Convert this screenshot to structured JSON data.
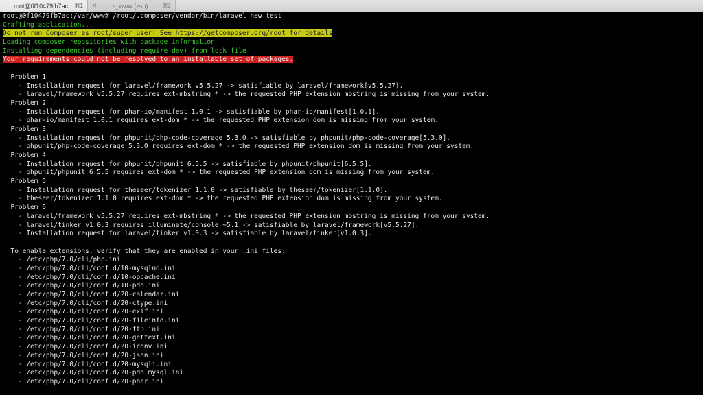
{
  "tabs": [
    {
      "title": "root@0f10479fb7ac:...",
      "shortcut": "⌘1",
      "close": ""
    },
    {
      "title": "~_www (zsh)",
      "shortcut": "⌘2",
      "close": "✕"
    }
  ],
  "colors": {
    "info_text": "#3fcc2f",
    "warning_bg": "#c6cc16",
    "error_bg": "#cc2222",
    "default_text": "#e8e8e8",
    "background": "#000000"
  },
  "terminal": {
    "command_line": "root@0f10479fb7ac:/var/www# /root/.composer/vendor/bin/laravel new test",
    "crafting": "Crafting application...",
    "warning": "Do not run Composer as root/super user! See https://getcomposer.org/root for details",
    "loading": "Loading composer repositories with package information",
    "installing": "Installing dependencies (including require-dev) from lock file",
    "error": "Your requirements could not be resolved to an installable set of packages.",
    "blank1": "",
    "p1": "  Problem 1",
    "p1_l1": "    - Installation request for laravel/framework v5.5.27 -> satisfiable by laravel/framework[v5.5.27].",
    "p1_l2": "    - laravel/framework v5.5.27 requires ext-mbstring * -> the requested PHP extension mbstring is missing from your system.",
    "p2": "  Problem 2",
    "p2_l1": "    - Installation request for phar-io/manifest 1.0.1 -> satisfiable by phar-io/manifest[1.0.1].",
    "p2_l2": "    - phar-io/manifest 1.0.1 requires ext-dom * -> the requested PHP extension dom is missing from your system.",
    "p3": "  Problem 3",
    "p3_l1": "    - Installation request for phpunit/php-code-coverage 5.3.0 -> satisfiable by phpunit/php-code-coverage[5.3.0].",
    "p3_l2": "    - phpunit/php-code-coverage 5.3.0 requires ext-dom * -> the requested PHP extension dom is missing from your system.",
    "p4": "  Problem 4",
    "p4_l1": "    - Installation request for phpunit/phpunit 6.5.5 -> satisfiable by phpunit/phpunit[6.5.5].",
    "p4_l2": "    - phpunit/phpunit 6.5.5 requires ext-dom * -> the requested PHP extension dom is missing from your system.",
    "p5": "  Problem 5",
    "p5_l1": "    - Installation request for theseer/tokenizer 1.1.0 -> satisfiable by theseer/tokenizer[1.1.0].",
    "p5_l2": "    - theseer/tokenizer 1.1.0 requires ext-dom * -> the requested PHP extension dom is missing from your system.",
    "p6": "  Problem 6",
    "p6_l1": "    - laravel/framework v5.5.27 requires ext-mbstring * -> the requested PHP extension mbstring is missing from your system.",
    "p6_l2": "    - laravel/tinker v1.0.3 requires illuminate/console ~5.1 -> satisfiable by laravel/framework[v5.5.27].",
    "p6_l3": "    - Installation request for laravel/tinker v1.0.3 -> satisfiable by laravel/tinker[v1.0.3].",
    "blank2": "",
    "enable": "  To enable extensions, verify that they are enabled in your .ini files:",
    "ini1": "    - /etc/php/7.0/cli/php.ini",
    "ini2": "    - /etc/php/7.0/cli/conf.d/10-mysqlnd.ini",
    "ini3": "    - /etc/php/7.0/cli/conf.d/10-opcache.ini",
    "ini4": "    - /etc/php/7.0/cli/conf.d/10-pdo.ini",
    "ini5": "    - /etc/php/7.0/cli/conf.d/20-calendar.ini",
    "ini6": "    - /etc/php/7.0/cli/conf.d/20-ctype.ini",
    "ini7": "    - /etc/php/7.0/cli/conf.d/20-exif.ini",
    "ini8": "    - /etc/php/7.0/cli/conf.d/20-fileinfo.ini",
    "ini9": "    - /etc/php/7.0/cli/conf.d/20-ftp.ini",
    "ini10": "    - /etc/php/7.0/cli/conf.d/20-gettext.ini",
    "ini11": "    - /etc/php/7.0/cli/conf.d/20-iconv.ini",
    "ini12": "    - /etc/php/7.0/cli/conf.d/20-json.ini",
    "ini13": "    - /etc/php/7.0/cli/conf.d/20-mysqli.ini",
    "ini14": "    - /etc/php/7.0/cli/conf.d/20-pdo_mysql.ini",
    "ini15": "    - /etc/php/7.0/cli/conf.d/20-phar.ini"
  }
}
